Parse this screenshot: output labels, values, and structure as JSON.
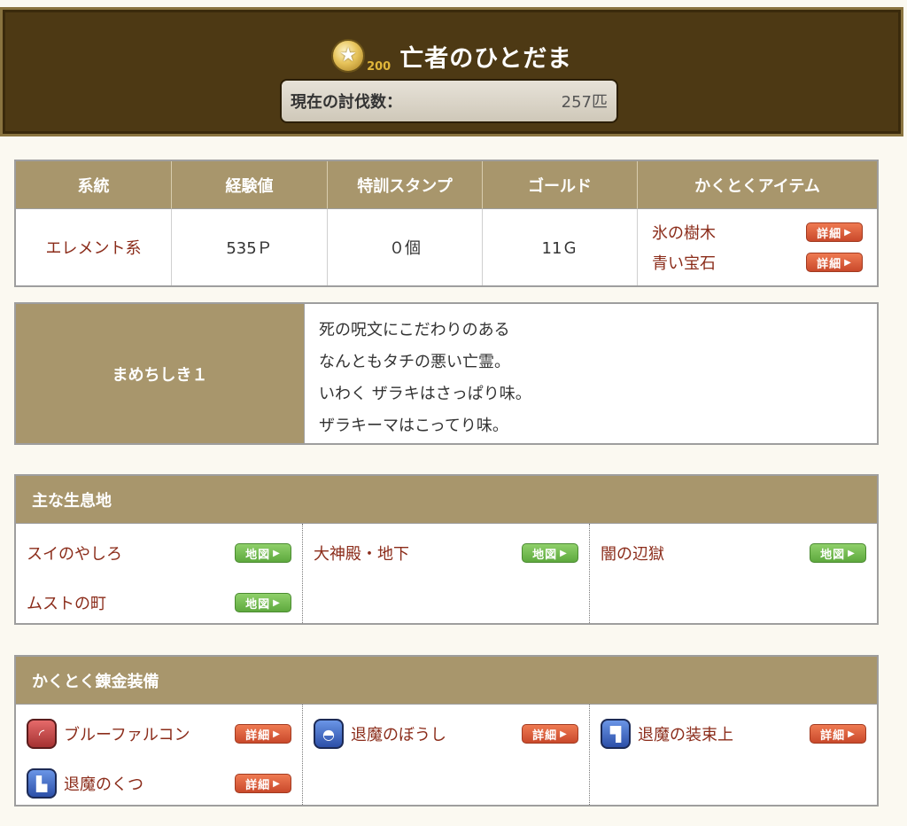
{
  "header": {
    "medal_number": "200",
    "title": "亡者のひとだま",
    "kill_label": "現在の討伐数：",
    "kill_value": "257匹"
  },
  "stats": {
    "headers": [
      "系統",
      "経験値",
      "特訓スタンプ",
      "ゴールド",
      "かくとくアイテム"
    ],
    "type": "エレメント系",
    "exp": "535Ｐ",
    "stamp": "０個",
    "gold": "11Ｇ",
    "items": [
      "氷の樹木",
      "青い宝石"
    ]
  },
  "trivia": {
    "label": "まめちしき１",
    "lines": [
      "死の呪文にこだわりのある",
      "なんともタチの悪い亡霊。",
      "いわく ザラキはさっぱり味。",
      "ザラキーマはこってり味。"
    ]
  },
  "habitat": {
    "title": "主な生息地",
    "places": [
      "スイのやしろ",
      "ムストの町",
      "大神殿・地下",
      "闇の辺獄"
    ]
  },
  "equipment": {
    "title": "かくとく錬金装備",
    "items": [
      {
        "name": "ブルーファルコン",
        "icon": "boomerang-icon"
      },
      {
        "name": "退魔のくつ",
        "icon": "boots-icon"
      },
      {
        "name": "退魔のぼうし",
        "icon": "helmet-icon"
      },
      {
        "name": "退魔の装束上",
        "icon": "armor-icon"
      }
    ]
  },
  "buttons": {
    "detail": "詳細",
    "map": "地図"
  },
  "colors": {
    "header_bg": "#4d3914",
    "tan": "#a8966c",
    "link_red": "#8b2c1a",
    "detail_button": "#d9573a",
    "map_button": "#6fba4b"
  }
}
